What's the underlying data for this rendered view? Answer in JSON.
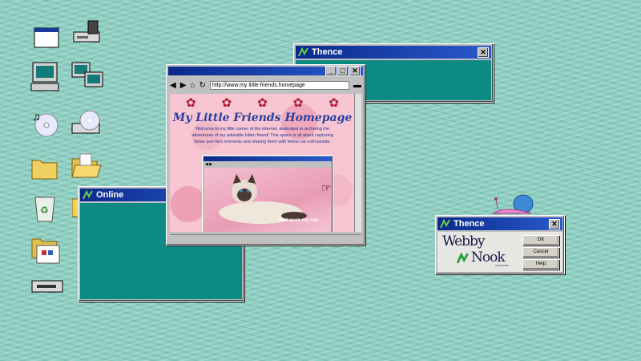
{
  "desktop": {
    "icons": [
      "window-icon",
      "drive-icon",
      "computer-icon",
      "network-icon",
      "music-cd-icon",
      "cd-drive-icon",
      "folder-icon",
      "open-folder-icon",
      "recycle-bin-icon",
      "floppy-icon",
      "programs-folder-icon",
      "tape-drive-icon"
    ]
  },
  "thence_top": {
    "title": "Thence",
    "close": "✕"
  },
  "online": {
    "title": "Online"
  },
  "browser": {
    "url": "http://www.my little friends.homepage",
    "heading": "My Little Friends Homepage",
    "intro": "Welcome to my little corner of the internet, dedicated to archiving the adventures of my adorable kitten friend! This space is all about capturing those purr-fect moments and sharing them with fellow cat enthusiasts.",
    "inner_caption": "Just open my can."
  },
  "thence_dialog": {
    "title": "Thence",
    "close": "✕",
    "logo_line1": "Webby",
    "logo_line2": "Nook",
    "logo_small": "NETWORK",
    "buttons": [
      "OK",
      "Cancel",
      "Help"
    ]
  },
  "colors": {
    "teal": "#0e8a84",
    "titlebar": "#0a2a8a",
    "desktop": "#8fcfc2"
  }
}
